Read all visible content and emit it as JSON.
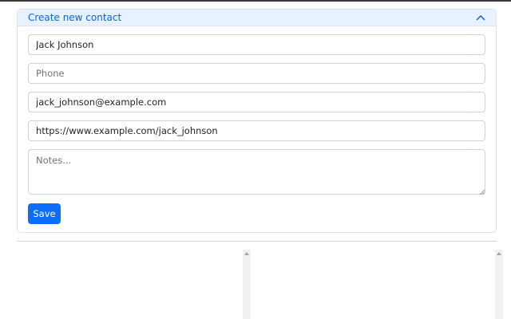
{
  "form": {
    "title": "Create new contact",
    "name": {
      "value": "Jack Johnson",
      "placeholder": ""
    },
    "phone": {
      "value": "",
      "placeholder": "Phone"
    },
    "email": {
      "value": "jack_johnson@example.com",
      "placeholder": ""
    },
    "website": {
      "value": "https://www.example.com/jack_johnson",
      "placeholder": ""
    },
    "notes": {
      "value": "",
      "placeholder": "Notes..."
    },
    "save_label": "Save",
    "collapse_icon": "chevron-up-icon"
  },
  "colors": {
    "accent": "#0d6efd",
    "header_bg": "#e7f1ff",
    "header_text": "#0c63e4"
  }
}
